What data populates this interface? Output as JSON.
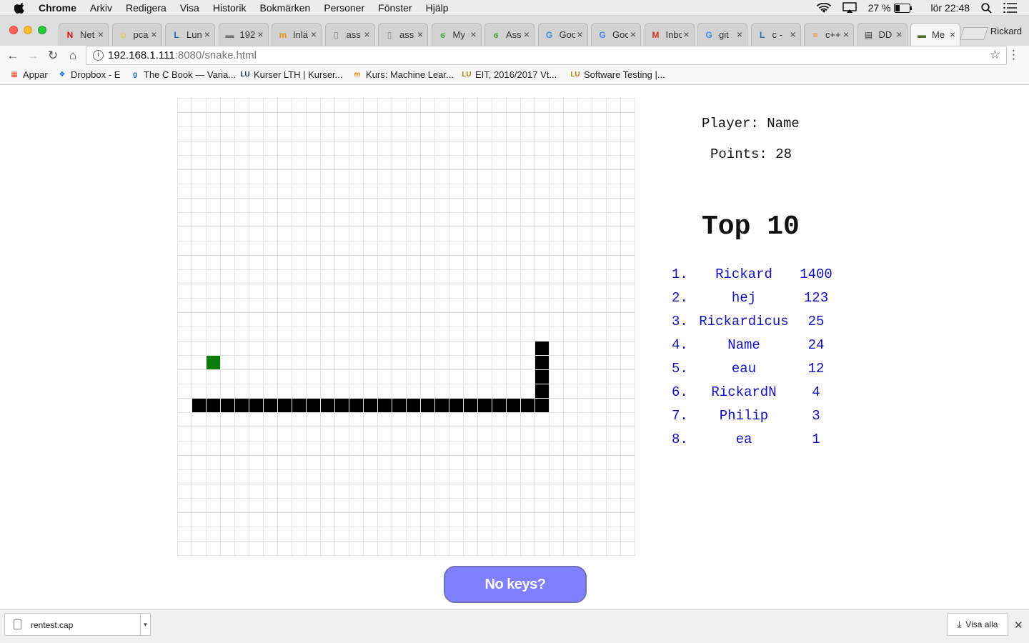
{
  "menubar": {
    "app": "Chrome",
    "items": [
      "Arkiv",
      "Redigera",
      "Visa",
      "Historik",
      "Bokmärken",
      "Personer",
      "Fönster",
      "Hjälp"
    ],
    "battery": "27 %",
    "clock": "lör 22:48"
  },
  "tabs": [
    {
      "label": "Net",
      "icon": "netflix-icon",
      "color": "#e50914",
      "glyph": "N"
    },
    {
      "label": "pca",
      "icon": "smiley-icon",
      "color": "#f0c000",
      "glyph": "☺"
    },
    {
      "label": "Lun",
      "icon": "lund-icon",
      "color": "#2a6bc4",
      "glyph": "L"
    },
    {
      "label": "192",
      "icon": "tank-icon",
      "color": "#777777",
      "glyph": "▬"
    },
    {
      "label": "Inlä",
      "icon": "fm-icon",
      "color": "#f08c00",
      "glyph": "m"
    },
    {
      "label": "ass",
      "icon": "document-icon",
      "color": "#888888",
      "glyph": "▯"
    },
    {
      "label": "ass",
      "icon": "document-icon",
      "color": "#888888",
      "glyph": "▯"
    },
    {
      "label": "My",
      "icon": "leaf-icon",
      "color": "#3aa03a",
      "glyph": "ϭ"
    },
    {
      "label": "Ass",
      "icon": "leaf-icon",
      "color": "#3aa03a",
      "glyph": "ϭ"
    },
    {
      "label": "Goo",
      "icon": "google-icon",
      "color": "#4285f4",
      "glyph": "G"
    },
    {
      "label": "Goo",
      "icon": "google-icon",
      "color": "#4285f4",
      "glyph": "G"
    },
    {
      "label": "Inbo",
      "icon": "gmail-icon",
      "color": "#d93025",
      "glyph": "M"
    },
    {
      "label": "git",
      "icon": "google-icon",
      "color": "#4285f4",
      "glyph": "G"
    },
    {
      "label": "c -",
      "icon": "lund-icon",
      "color": "#2a6bc4",
      "glyph": "L"
    },
    {
      "label": "c++",
      "icon": "stack-icon",
      "color": "#f48024",
      "glyph": "≡"
    },
    {
      "label": "DD",
      "icon": "ddwrt-icon",
      "color": "#444444",
      "glyph": "▤"
    },
    {
      "label": "Me",
      "icon": "tank-icon",
      "color": "#556b2f",
      "glyph": "▬",
      "active": true
    }
  ],
  "profile": "Rickard",
  "address": {
    "host": "192.168.1.111",
    "path": ":8080/snake.html"
  },
  "bookmarks": [
    {
      "label": "Appar",
      "icon": "apps-grid-icon",
      "color": "#e04a2b",
      "glyph": "▦"
    },
    {
      "label": "Dropbox - E",
      "icon": "dropbox-icon",
      "color": "#0061fe",
      "glyph": "❖"
    },
    {
      "label": "The C Book — Varia...",
      "icon": "gnu-icon",
      "color": "#1a66b8",
      "glyph": "g"
    },
    {
      "label": "Kurser LTH | Kurser...",
      "icon": "lu-icon",
      "color": "#1a2a7a",
      "glyph": "LU"
    },
    {
      "label": "Kurs: Machine Lear...",
      "icon": "fm-icon",
      "color": "#f08c00",
      "glyph": "m"
    },
    {
      "label": "EIT, 2016/2017 Vt...",
      "icon": "lu-icon",
      "color": "#b8860b",
      "glyph": "LU"
    },
    {
      "label": "Software Testing |...",
      "icon": "lu-icon",
      "color": "#b8860b",
      "glyph": "LU"
    }
  ],
  "game": {
    "player_text": "Player: Name",
    "points_text": "Points: 28",
    "top_title": "Top 10",
    "grid_cells": 32,
    "food": {
      "col": 2,
      "row": 18
    },
    "snake": [
      [
        1,
        21
      ],
      [
        2,
        21
      ],
      [
        3,
        21
      ],
      [
        4,
        21
      ],
      [
        5,
        21
      ],
      [
        6,
        21
      ],
      [
        7,
        21
      ],
      [
        8,
        21
      ],
      [
        9,
        21
      ],
      [
        10,
        21
      ],
      [
        11,
        21
      ],
      [
        12,
        21
      ],
      [
        13,
        21
      ],
      [
        14,
        21
      ],
      [
        15,
        21
      ],
      [
        16,
        21
      ],
      [
        17,
        21
      ],
      [
        18,
        21
      ],
      [
        19,
        21
      ],
      [
        20,
        21
      ],
      [
        21,
        21
      ],
      [
        22,
        21
      ],
      [
        23,
        21
      ],
      [
        24,
        21
      ],
      [
        25,
        21
      ],
      [
        25,
        20
      ],
      [
        25,
        19
      ],
      [
        25,
        18
      ],
      [
        25,
        17
      ]
    ],
    "leaderboard": [
      {
        "rank": "1.",
        "name": "Rickard",
        "score": "1400"
      },
      {
        "rank": "2.",
        "name": "hej",
        "score": "123"
      },
      {
        "rank": "3.",
        "name": "Rickardicus",
        "score": "25"
      },
      {
        "rank": "4.",
        "name": "Name",
        "score": "24"
      },
      {
        "rank": "5.",
        "name": "eau",
        "score": "12"
      },
      {
        "rank": "6.",
        "name": "RickardN",
        "score": "4"
      },
      {
        "rank": "7.",
        "name": "Philip",
        "score": "3"
      },
      {
        "rank": "8.",
        "name": "ea",
        "score": "1"
      }
    ],
    "button_label": "No keys?"
  },
  "download": {
    "file": "rentest.cap",
    "show_all": "Visa alla"
  }
}
